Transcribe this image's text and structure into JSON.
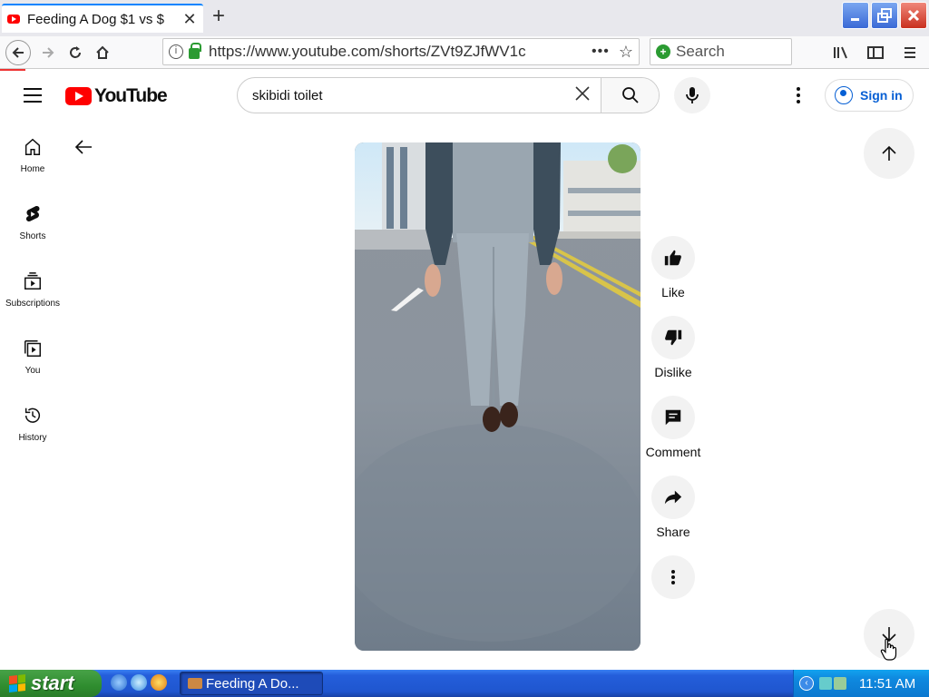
{
  "browser": {
    "tab_title": "Feeding A Dog $1 vs $",
    "tab_close": "✕",
    "new_tab": "+",
    "url": "https://www.youtube.com/shorts/ZVt9ZJfWV1c",
    "url_more": "•••",
    "search_placeholder": "Search"
  },
  "youtube": {
    "logo_text": "YouTube",
    "search_query": "skibidi toilet",
    "signin_label": "Sign in",
    "sidebar": [
      {
        "label": "Home",
        "icon": "home-icon"
      },
      {
        "label": "Shorts",
        "icon": "shorts-icon"
      },
      {
        "label": "Subscriptions",
        "icon": "subscriptions-icon"
      },
      {
        "label": "You",
        "icon": "you-icon"
      },
      {
        "label": "History",
        "icon": "history-icon"
      }
    ],
    "actions": [
      {
        "label": "Like",
        "icon": "thumbs-up-icon"
      },
      {
        "label": "Dislike",
        "icon": "thumbs-down-icon"
      },
      {
        "label": "Comment",
        "icon": "comment-icon"
      },
      {
        "label": "Share",
        "icon": "share-icon"
      },
      {
        "label": "",
        "icon": "more-icon"
      }
    ]
  },
  "taskbar": {
    "start_label": "start",
    "task_item": "Feeding A Do...",
    "clock": "11:51 AM"
  },
  "colors": {
    "youtube_red": "#ff0000",
    "signin_blue": "#065fd4",
    "xp_start_green": "#2f8d2f",
    "xp_taskbar_blue": "#245edb"
  }
}
